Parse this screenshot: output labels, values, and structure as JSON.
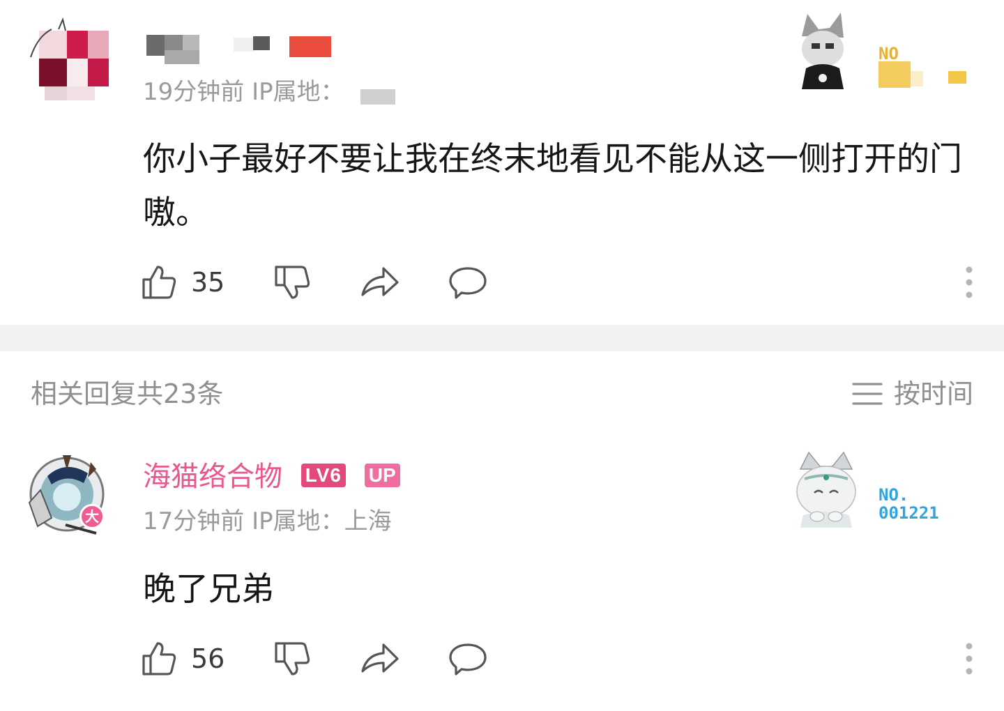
{
  "comment1": {
    "username": "",
    "meta": "19分钟前 IP属地：",
    "body": "你小子最好不要让我在终末地看见不能从这一侧打开的门嗷。",
    "like_count": "35",
    "garb_label": "NO"
  },
  "replies": {
    "title": "相关回复共23条",
    "sort_label": "按时间"
  },
  "comment2": {
    "username": "海猫络合物",
    "level": "LV6",
    "up_badge": "UP",
    "meta": "17分钟前 IP属地：上海",
    "body": "晚了兄弟",
    "like_count": "56",
    "vip_tag": "大",
    "garb_label_line1": "NO.",
    "garb_label_line2": "001221"
  },
  "colors": {
    "username_pink": "#e8578e",
    "meta_gray": "#9a9a9a",
    "divider_gray": "#f1f2f4",
    "garb_blue": "#2fa4e0"
  },
  "icons": [
    "thumbs-up-icon",
    "thumbs-down-icon",
    "share-icon",
    "reply-icon",
    "more-icon",
    "sort-icon"
  ]
}
